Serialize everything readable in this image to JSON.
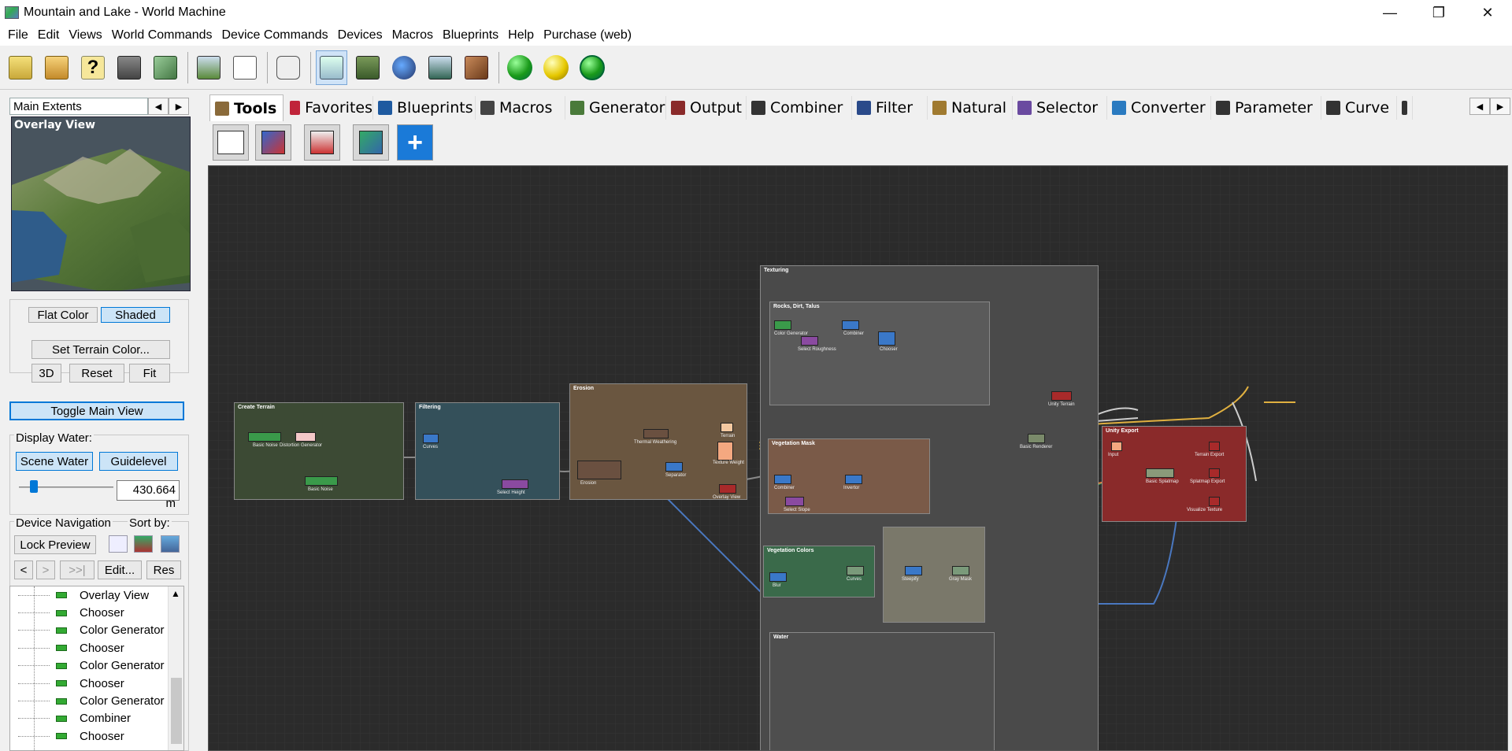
{
  "window": {
    "title": "Mountain and Lake - World Machine"
  },
  "menu": [
    "File",
    "Edit",
    "Views",
    "World Commands",
    "Device Commands",
    "Devices",
    "Macros",
    "Blueprints",
    "Help",
    "Purchase (web)"
  ],
  "left_panel": {
    "extents_label": "Main Extents",
    "overlay_title": "Overlay View",
    "flat_color": "Flat Color",
    "shaded": "Shaded",
    "set_terrain_color": "Set Terrain Color...",
    "btn_3d": "3D",
    "btn_reset": "Reset",
    "btn_fit": "Fit",
    "toggle_main_view": "Toggle Main View",
    "display_water": "Display Water:",
    "scene_water": "Scene Water",
    "guidelevel": "Guidelevel",
    "water_level_value": "430.664 m",
    "water_slider_fraction": 0.12,
    "device_navigation": "Device Navigation",
    "sort_by": "Sort by:",
    "lock_preview": "Lock Preview",
    "nav_prev": "<",
    "nav_next": ">",
    "nav_last": ">>|",
    "edit": "Edit...",
    "res": "Res",
    "tree_items": [
      "Overlay View",
      "Chooser",
      "Color Generator",
      "Chooser",
      "Color Generator",
      "Chooser",
      "Color Generator",
      "Combiner",
      "Chooser"
    ]
  },
  "tabs": [
    "Tools",
    "Favorites",
    "Blueprints",
    "Macros",
    "Generator",
    "Output",
    "Combiner",
    "Filter",
    "Natural",
    "Selector",
    "Converter",
    "Parameter",
    "Curve"
  ],
  "tab_colors": [
    "#8a6a3a",
    "#c0243a",
    "#1e5aa0",
    "#444",
    "#4a7a3a",
    "#8a2a2a",
    "#333",
    "#2a4a8a",
    "#a07a30",
    "#6a4aa0",
    "#2a7ac0",
    "#333",
    "#333"
  ],
  "canvas_groups": {
    "create_terrain": "Create Terrain",
    "filtering": "Filtering",
    "erosion": "Erosion",
    "texturing": "Texturing",
    "rocks": "Rocks, Dirt, Talus",
    "vegetation_mask": "Vegetation Mask",
    "vegetation_colors": "Vegetation Colors",
    "unity_export": "Unity Export",
    "water": "Water"
  },
  "canvas_devices": {
    "basic_noise": "Basic Noise",
    "distortion": "Distortion Generator",
    "basic_noise2": "Basic Noise",
    "curves": "Curves",
    "select_height": "Select Height",
    "thermal": "Thermal Weathering",
    "erosion": "Erosion",
    "overlay_view": "Overlay View",
    "terrain": "Terrain",
    "unity_terrain": "Unity Terrain",
    "input": "Input",
    "terrain_export": "Terrain Export",
    "splatmap_export": "Splatmap Export",
    "basic_splatmap": "Basic Splatmap",
    "visualize_texture": "Visualize Texture",
    "basic_renderer": "Basic Renderer",
    "chooser": "Chooser",
    "combiner": "Combiner",
    "color_gen": "Color Generator",
    "select_slope": "Select Slope",
    "blur": "Blur",
    "select_roughness": "Select Roughness",
    "texture_weight": "Texture Weight",
    "separator": "Separator",
    "invertor": "Invertor",
    "curves2": "Curves",
    "steepify": "Steepify",
    "gray_mask": "Gray Mask"
  }
}
